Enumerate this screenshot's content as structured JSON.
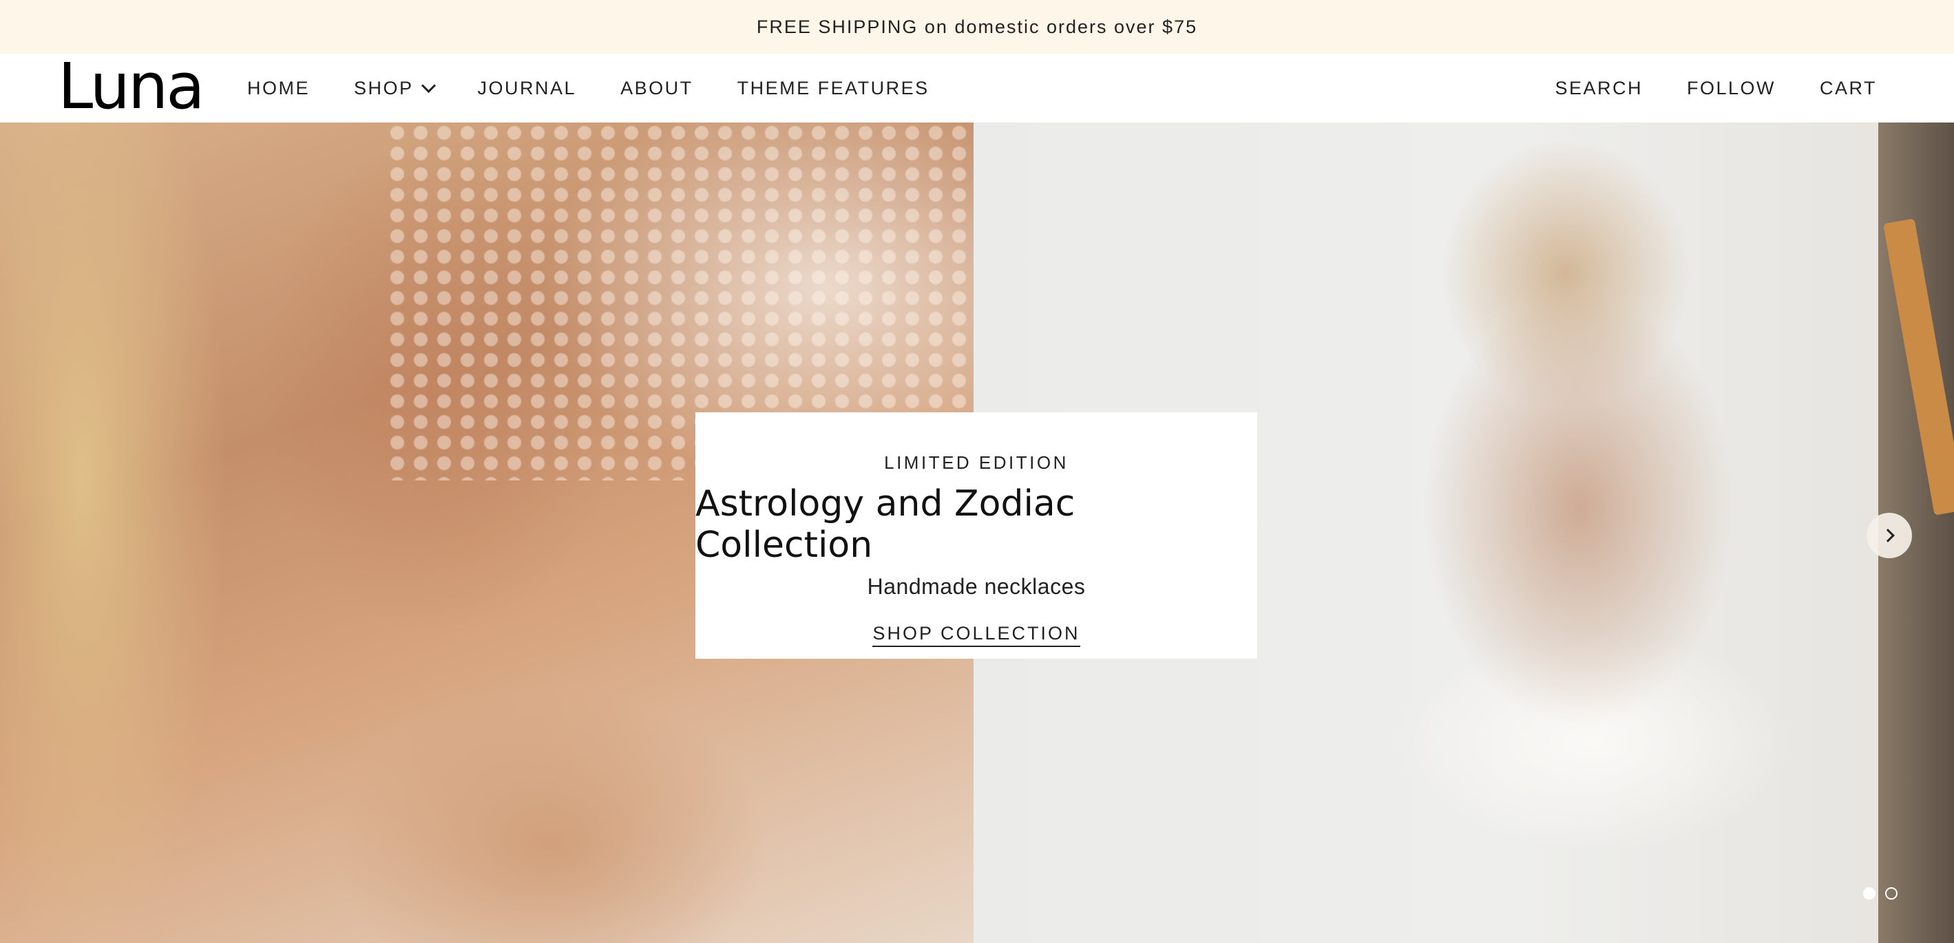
{
  "announcement": {
    "text": "FREE SHIPPING on domestic orders over $75"
  },
  "header": {
    "logo": "Luna",
    "nav_left": [
      {
        "label": "HOME"
      },
      {
        "label": "SHOP",
        "has_dropdown": true
      },
      {
        "label": "JOURNAL"
      },
      {
        "label": "ABOUT"
      },
      {
        "label": "THEME FEATURES"
      }
    ],
    "nav_right": [
      {
        "label": "SEARCH"
      },
      {
        "label": "FOLLOW"
      },
      {
        "label": "CART"
      }
    ]
  },
  "hero": {
    "eyebrow": "LIMITED EDITION",
    "title": "Astrology and Zodiac Collection",
    "subtitle": "Handmade necklaces",
    "cta": "SHOP COLLECTION",
    "slides_total": 2,
    "active_slide": 1,
    "next_icon": "chevron-right-icon"
  },
  "colors": {
    "announcement_bg": "#fdf6e9",
    "text": "#1a1a1a",
    "card_bg": "#ffffff"
  }
}
